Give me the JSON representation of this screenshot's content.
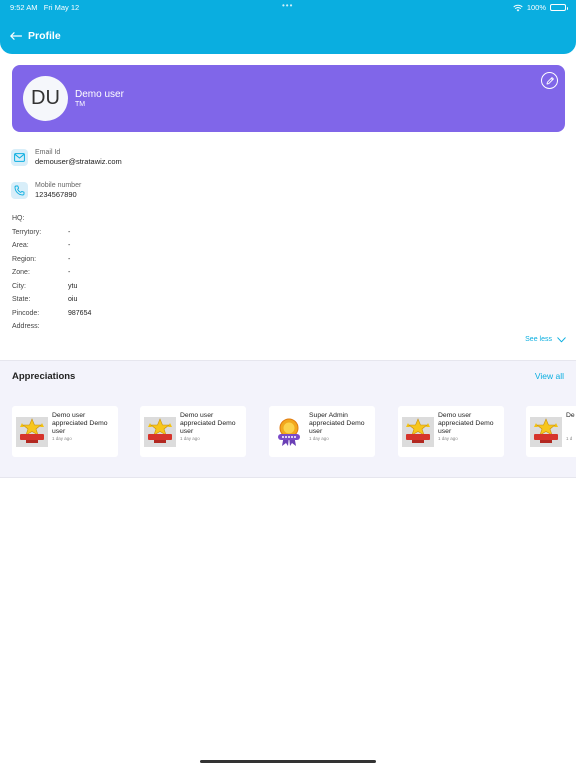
{
  "status_bar": {
    "time": "9:52 AM",
    "date": "Fri May 12",
    "battery": "100%",
    "dots": "•••"
  },
  "header": {
    "back_label": "Profile"
  },
  "profile": {
    "initials": "DU",
    "name": "Demo user",
    "role": "TM"
  },
  "contacts": {
    "email": {
      "label": "Email Id",
      "value": "demouser@stratawiz.com"
    },
    "phone": {
      "label": "Mobile number",
      "value": "1234567890"
    }
  },
  "details": [
    {
      "key": "HQ:",
      "value": ""
    },
    {
      "key": "Terrytory:",
      "value": "-"
    },
    {
      "key": "Area:",
      "value": "-"
    },
    {
      "key": "Region:",
      "value": "-"
    },
    {
      "key": "Zone:",
      "value": "-"
    },
    {
      "key": "City:",
      "value": "ytu"
    },
    {
      "key": "State:",
      "value": "oiu"
    },
    {
      "key": "Pincode:",
      "value": "987654"
    },
    {
      "key": "Address:",
      "value": ""
    }
  ],
  "see_less": "See less",
  "appreciations": {
    "title": "Appreciations",
    "view_all": "View all",
    "items": [
      {
        "text": "Demo user appreciated Demo user",
        "ago": "1 day ago",
        "badge": "stars-badge-icon"
      },
      {
        "text": "Demo user appreciated Demo user",
        "ago": "1 day ago",
        "badge": "stars-badge-icon"
      },
      {
        "text": "Super Admin appreciated Demo user",
        "ago": "1 day ago",
        "badge": "bravo-badge-icon"
      },
      {
        "text": "Demo user appreciated Demo user",
        "ago": "1 day ago",
        "badge": "stars-badge-icon"
      },
      {
        "text": "De",
        "ago": "1 d",
        "badge": "stars-badge-icon"
      }
    ]
  },
  "colors": {
    "header": "#0aaee0",
    "profile_card": "#8066e9",
    "accent": "#0aaee0"
  }
}
